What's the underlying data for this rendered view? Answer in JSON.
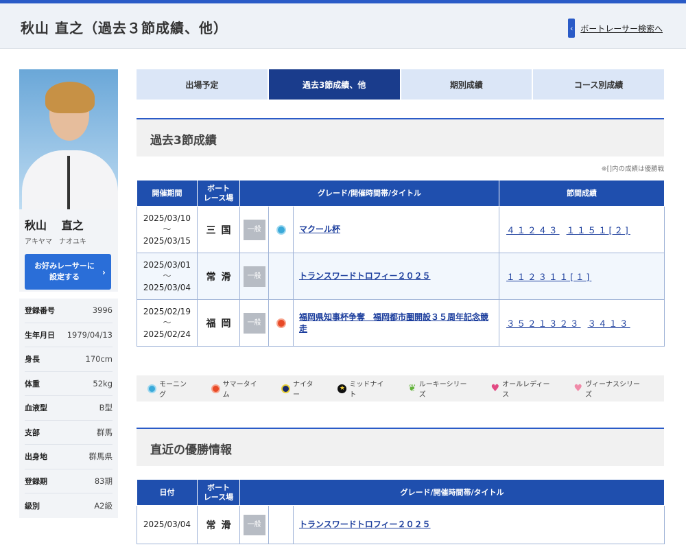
{
  "header": {
    "title": "秋山 直之（過去３節成績、他）",
    "search_link": "ボートレーサー検索へ"
  },
  "profile": {
    "name": "秋山　 直之",
    "kana": "アキヤマ　ナオユキ",
    "fav_button": "お好みレーサーに\n設定する",
    "info": [
      {
        "key": "登録番号",
        "value": "3996"
      },
      {
        "key": "生年月日",
        "value": "1979/04/13"
      },
      {
        "key": "身長",
        "value": "170cm"
      },
      {
        "key": "体重",
        "value": "52kg"
      },
      {
        "key": "血液型",
        "value": "B型"
      },
      {
        "key": "支部",
        "value": "群馬"
      },
      {
        "key": "出身地",
        "value": "群馬県"
      },
      {
        "key": "登録期",
        "value": "83期"
      },
      {
        "key": "級別",
        "value": "A2級"
      }
    ]
  },
  "tabs": [
    "出場予定",
    "過去3節成績、他",
    "期別成績",
    "コース別成績"
  ],
  "past3": {
    "title": "過去3節成績",
    "note": "※[]内の成績は優勝戦",
    "headers": {
      "period": "開催期間",
      "venue": "ボート\nレース場",
      "grade": "グレード/開催時間帯/タイトル",
      "results": "節間成績"
    },
    "rows": [
      {
        "start": "2025/03/10",
        "tilde": "～",
        "end": "2025/03/15",
        "venue": "三国",
        "grade": "一般",
        "time_icon": "morning-icon",
        "title": "マクール杯",
        "results": [
          "４１２４３",
          "１１５１[２]"
        ]
      },
      {
        "start": "2025/03/01",
        "tilde": "～",
        "end": "2025/03/04",
        "venue": "常滑",
        "grade": "一般",
        "time_icon": "",
        "title": "トランスワードトロフィー２０２５",
        "results": [
          "１１２３１１[１]"
        ]
      },
      {
        "start": "2025/02/19",
        "tilde": "～",
        "end": "2025/02/24",
        "venue": "福岡",
        "grade": "一般",
        "time_icon": "summer-time-icon",
        "title": "福岡県知事杯争奪　福岡都市圏開設３５周年記念競走",
        "results": [
          "３５２１３２３",
          "３４１３"
        ]
      }
    ]
  },
  "legend": [
    {
      "icon": "morning-icon",
      "label": "モーニング"
    },
    {
      "icon": "summer-time-icon",
      "label": "サマータイム"
    },
    {
      "icon": "nighter-icon",
      "label": "ナイター"
    },
    {
      "icon": "midnight-icon",
      "label": "ミッドナイト"
    },
    {
      "icon": "rookie-icon",
      "label": "ルーキーシリーズ"
    },
    {
      "icon": "all-ladies-icon",
      "label": "オールレディース"
    },
    {
      "icon": "venus-icon",
      "label": "ヴィーナスシリーズ"
    }
  ],
  "wins": {
    "title": "直近の優勝情報",
    "headers": {
      "date": "日付",
      "venue": "ボート\nレース場",
      "grade": "グレード/開催時間帯/タイトル"
    },
    "rows": [
      {
        "date": "2025/03/04",
        "venue": "常滑",
        "grade": "一般",
        "title": "トランスワードトロフィー２０２５"
      }
    ]
  },
  "colors": {
    "accent": "#1f4fae",
    "active_tab": "#1a3c8c",
    "link": "#1a3c9c"
  }
}
